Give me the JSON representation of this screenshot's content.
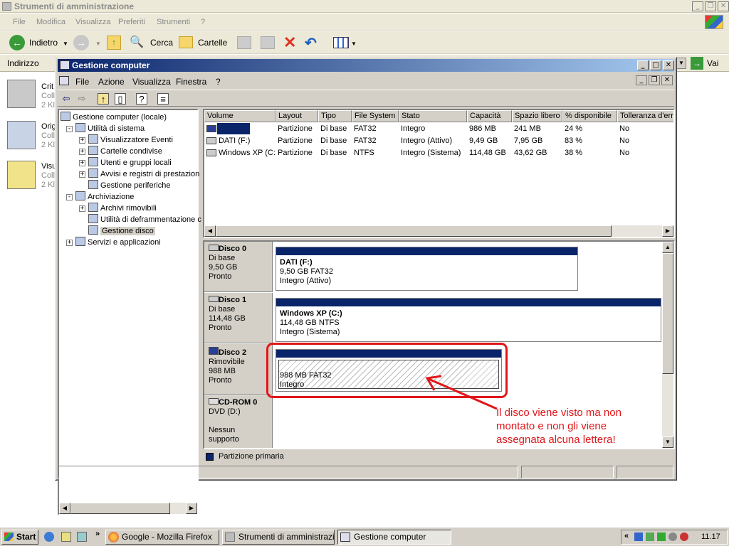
{
  "outer": {
    "title": "Strumenti di amministrazione",
    "menu": [
      "File",
      "Modifica",
      "Visualizza",
      "Preferiti",
      "Strumenti",
      "?"
    ],
    "toolbar": {
      "back": "Indietro",
      "search": "Cerca",
      "folders": "Cartelle"
    },
    "address_label": "Indirizzo",
    "go_label": "Vai",
    "left_items": [
      {
        "line1": "Crit",
        "line2": "Coll",
        "line3": "2 Kl"
      },
      {
        "line1": "Orig",
        "line2": "Coll",
        "line3": "2 Kl"
      },
      {
        "line1": "Visu",
        "line2": "Coll",
        "line3": "2 Kl"
      }
    ]
  },
  "mmc": {
    "title": "Gestione computer",
    "menu": [
      "File",
      "Azione",
      "Visualizza",
      "Finestra",
      "?"
    ],
    "tree": [
      {
        "label": "Gestione computer (locale)",
        "level": 0,
        "expander": ""
      },
      {
        "label": "Utilità di sistema",
        "level": 1,
        "expander": "−"
      },
      {
        "label": "Visualizzatore Eventi",
        "level": 2,
        "expander": "+"
      },
      {
        "label": "Cartelle condivise",
        "level": 2,
        "expander": "+"
      },
      {
        "label": "Utenti e gruppi locali",
        "level": 2,
        "expander": "+"
      },
      {
        "label": "Avvisi e registri di prestazion",
        "level": 2,
        "expander": "+"
      },
      {
        "label": "Gestione periferiche",
        "level": 2,
        "expander": ""
      },
      {
        "label": "Archiviazione",
        "level": 1,
        "expander": "−"
      },
      {
        "label": "Archivi rimovibili",
        "level": 2,
        "expander": "+"
      },
      {
        "label": "Utilità di deframmentazione c",
        "level": 2,
        "expander": ""
      },
      {
        "label": "Gestione disco",
        "level": 2,
        "expander": "",
        "selected": true
      },
      {
        "label": "Servizi e applicazioni",
        "level": 1,
        "expander": "+"
      }
    ],
    "columns": [
      "Volume",
      "Layout",
      "Tipo",
      "File System",
      "Stato",
      "Capacità",
      "Spazio libero",
      "% disponibile",
      "Tolleranza d'err"
    ],
    "rows": [
      [
        "",
        "Partizione",
        "Di base",
        "FAT32",
        "Integro",
        "986 MB",
        "241 MB",
        "24 %",
        "No"
      ],
      [
        "DATI (F:)",
        "Partizione",
        "Di base",
        "FAT32",
        "Integro (Attivo)",
        "9,49 GB",
        "7,95 GB",
        "83 %",
        "No"
      ],
      [
        "Windows XP (C:)",
        "Partizione",
        "Di base",
        "NTFS",
        "Integro (Sistema)",
        "114,48 GB",
        "43,62 GB",
        "38 %",
        "No"
      ]
    ],
    "disks": [
      {
        "name": "Disco 0",
        "type": "Di base",
        "size": "9,50 GB",
        "status": "Pronto",
        "part_name": "DATI  (F:)",
        "part_size": "9,50 GB FAT32",
        "part_status": "Integro (Attivo)"
      },
      {
        "name": "Disco 1",
        "type": "Di base",
        "size": "114,48 GB",
        "status": "Pronto",
        "part_name": "Windows XP  (C:)",
        "part_size": "114,48 GB NTFS",
        "part_status": "Integro (Sistema)"
      },
      {
        "name": "Disco 2",
        "type": "Rimovibile",
        "size": "988 MB",
        "status": "Pronto",
        "part_name": "",
        "part_size": "988 MB FAT32",
        "part_status": "Integro"
      },
      {
        "name": "CD-ROM 0",
        "type": "DVD (D:)",
        "size": "",
        "status": "Nessun supporto"
      }
    ],
    "legend": "Partizione primaria",
    "annotation": "Il disco viene visto ma non\nmontato e non gli viene\nassegnata alcuna lettera!"
  },
  "taskbar": {
    "start": "Start",
    "buttons": [
      "Google - Mozilla Firefox",
      "Strumenti di amministrazi...",
      "Gestione computer"
    ],
    "time": "11.17"
  },
  "colors": {
    "accent": "#0a246a",
    "annotation": "#e0161a",
    "face": "#d4d0c8"
  }
}
